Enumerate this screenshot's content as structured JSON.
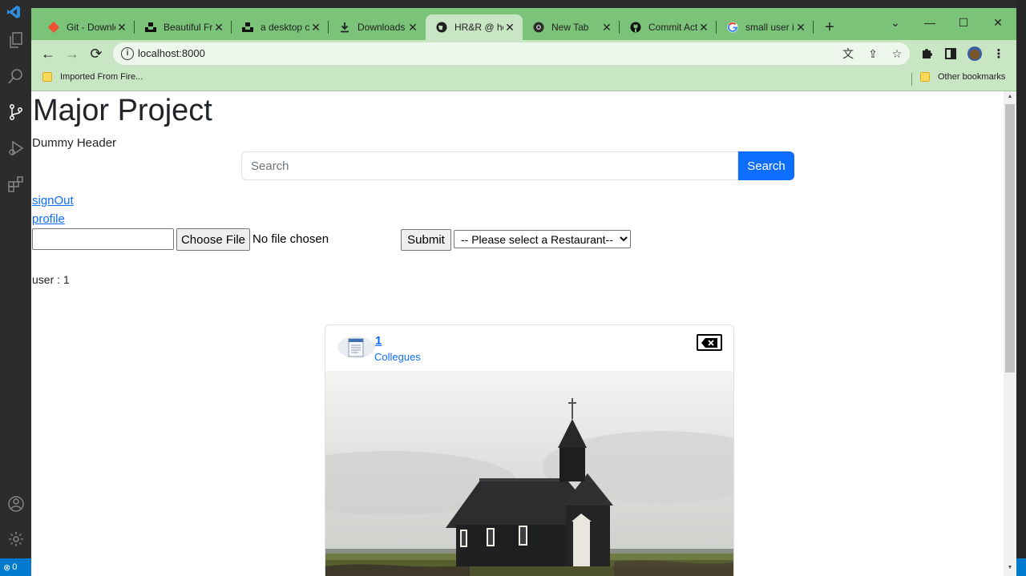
{
  "browser": {
    "tabs": [
      {
        "title": "Git - Downloads",
        "icon": "git-icon",
        "active": false
      },
      {
        "title": "Beautiful Free Images",
        "icon": "unsplash-icon",
        "active": false
      },
      {
        "title": "a desktop computer",
        "icon": "unsplash-icon",
        "active": false
      },
      {
        "title": "Downloads",
        "icon": "download-icon",
        "active": false
      },
      {
        "title": "HR&R @ home",
        "icon": "globe-icon",
        "active": true
      },
      {
        "title": "New Tab",
        "icon": "chrome-icon",
        "active": false
      },
      {
        "title": "Commit Activity",
        "icon": "github-icon",
        "active": false
      },
      {
        "title": "small user icon",
        "icon": "google-icon",
        "active": false
      }
    ],
    "url": "localhost:8000",
    "bookmarks": {
      "imported": "Imported From Fire...",
      "other": "Other bookmarks"
    }
  },
  "page": {
    "title": "Major Project",
    "header_text": "Dummy Header",
    "search": {
      "placeholder": "Search",
      "value": "",
      "button": "Search"
    },
    "links": {
      "sign_out": "signOut",
      "profile": "profile"
    },
    "upload": {
      "text_value": "",
      "choose_file": "Choose File",
      "no_file": "No file chosen",
      "submit": "Submit",
      "restaurant_select": "-- Please select a Restaurant--"
    },
    "user_line": "user : 1",
    "post": {
      "id": "1",
      "subtitle": "Collegues"
    }
  },
  "vscode": {
    "status_errors": "0"
  },
  "colors": {
    "tabstrip": "#7cc37a",
    "toolbar": "#c8e6c4",
    "primary": "#0d6efd",
    "statusbar": "#007acc"
  }
}
